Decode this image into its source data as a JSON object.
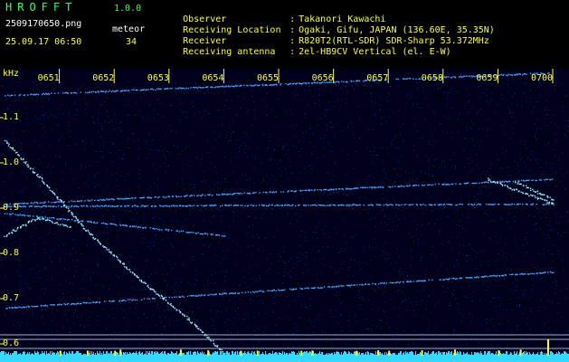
{
  "header": {
    "brand": "HROFFT",
    "version": "1.0.0",
    "filename": "2509170650.png",
    "datetime": "25.09.17 06:50",
    "meteor_label": "meteor",
    "meteor_count": "34",
    "info": [
      {
        "key": "Observer",
        "sep": ":",
        "value": "Takanori Kawachi"
      },
      {
        "key": "Receiving Location",
        "sep": ":",
        "value": "Ogaki, Gifu, JAPAN (136.60E, 35.35N)"
      },
      {
        "key": "Receiver",
        "sep": ":",
        "value": "R820T2(RTL-SDR) SDR-Sharp 53.372MHz"
      },
      {
        "key": "Receiving antenna",
        "sep": ":",
        "value": "2el-HB9CV Vertical (el. E-W)"
      }
    ]
  },
  "colors": {
    "background": "#00001a",
    "noise": "#1a3fc8",
    "trace": "#4aa8ff",
    "bright_trace": "#9ef0ff",
    "bar": "#ffff33",
    "bar_base": "#33d9ff",
    "label": "#ffff33",
    "header_green": "#33ff66"
  },
  "chart_data": {
    "type": "heatmap",
    "ylabel": "kHz",
    "x_ticks": [
      "0651",
      "0652",
      "0653",
      "0654",
      "0655",
      "0656",
      "0657",
      "0658",
      "0659",
      "0700"
    ],
    "y_ticks": [
      "1.1",
      "1.0",
      "0.9",
      "0.8",
      "0.7",
      "0.6"
    ],
    "ylim": [
      0.58,
      1.2
    ],
    "xlim_minutes": [
      50,
      60
    ],
    "reference_lines_khz": [
      0.62,
      0.61,
      0.59
    ],
    "traces": [
      {
        "points": [
          [
            50.0,
            1.15
          ],
          [
            60.0,
            1.2
          ]
        ]
      },
      {
        "points": [
          [
            50.0,
            0.91
          ],
          [
            60.0,
            0.965
          ]
        ]
      },
      {
        "points": [
          [
            50.0,
            0.905
          ],
          [
            60.0,
            0.91
          ]
        ]
      },
      {
        "points": [
          [
            50.0,
            0.89
          ],
          [
            54.0,
            0.84
          ]
        ]
      },
      {
        "points": [
          [
            50.0,
            0.68
          ],
          [
            60.0,
            0.76
          ]
        ]
      },
      {
        "points": [
          [
            58.8,
            0.965
          ],
          [
            60.0,
            0.91
          ]
        ]
      },
      {
        "points": [
          [
            59.3,
            0.96
          ],
          [
            60.0,
            0.92
          ]
        ]
      },
      {
        "points": [
          [
            50.0,
            0.84
          ],
          [
            50.6,
            0.88
          ],
          [
            51.2,
            0.86
          ]
        ]
      },
      {
        "points": [
          [
            50.0,
            1.05
          ],
          [
            50.7,
            0.96
          ],
          [
            51.5,
            0.85
          ],
          [
            52.5,
            0.74
          ],
          [
            53.5,
            0.64
          ],
          [
            54.0,
            0.58
          ]
        ]
      }
    ],
    "meteor_bars": [
      {
        "x": 51.0,
        "height": 0.11
      },
      {
        "x": 51.5,
        "height": 0.11
      },
      {
        "x": 52.0,
        "height": 0.1
      },
      {
        "x": 52.1,
        "height": 0.2
      },
      {
        "x": 53.2,
        "height": 0.2
      },
      {
        "x": 53.7,
        "height": 0.14
      },
      {
        "x": 54.3,
        "height": 0.1
      },
      {
        "x": 54.6,
        "height": 0.11
      },
      {
        "x": 55.4,
        "height": 0.1
      },
      {
        "x": 55.6,
        "height": 0.12
      },
      {
        "x": 56.4,
        "height": 0.1
      },
      {
        "x": 56.8,
        "height": 0.14
      },
      {
        "x": 57.0,
        "height": 0.1
      },
      {
        "x": 57.6,
        "height": 0.14
      },
      {
        "x": 58.2,
        "height": 0.2
      },
      {
        "x": 59.0,
        "height": 0.14
      },
      {
        "x": 59.4,
        "height": 0.2
      },
      {
        "x": 59.9,
        "height": 1.0
      }
    ]
  }
}
